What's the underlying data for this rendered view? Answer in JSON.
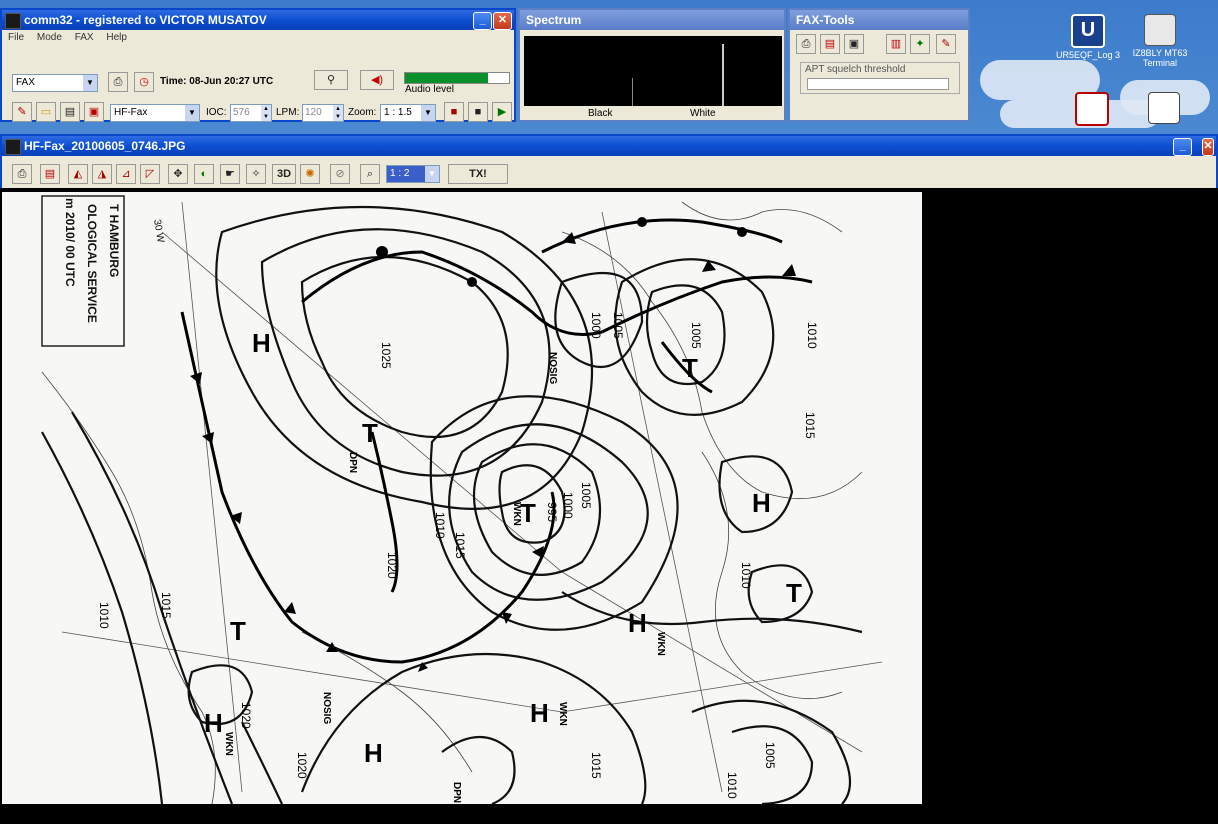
{
  "comm32": {
    "title": "comm32 - registered to VICTOR MUSATOV",
    "menu": [
      "File",
      "Mode",
      "FAX",
      "Help"
    ],
    "mode_select": "FAX",
    "time_text": "Time: 08-Jun 20:27 UTC",
    "audio_label": "Audio level",
    "audio_level": 0.8,
    "fax_type_select": "HF-Fax",
    "ioc_label": "IOC:",
    "ioc_value": "576",
    "lpm_label": "LPM:",
    "lpm_value": "120",
    "zoom_label": "Zoom:",
    "zoom_value": "1 : 1.5"
  },
  "spectrum": {
    "title": "Spectrum",
    "black_label": "Black",
    "white_label": "White"
  },
  "faxtools": {
    "title": "FAX-Tools",
    "apt_label": "APT squelch threshold"
  },
  "desktop_icons": [
    {
      "label": "UR5EQF_Log 3"
    },
    {
      "label": "IZ8BLY MT63 Terminal"
    }
  ],
  "faxwin": {
    "title": "HF-Fax_20100605_0746.JPG",
    "zoom_value": "1 : 2",
    "btn_3d": "3D",
    "btn_tx": "TX!"
  },
  "chart_text": {
    "header_line1": "T HAMBURG",
    "header_line2": "OLOGICAL SERVICE",
    "header_line3": "m 2010/ 00 UTC",
    "lon_30w": "30 W",
    "isobars": [
      "1025",
      "1000",
      "1005",
      "1005",
      "1010",
      "1015",
      "995",
      "1000",
      "1005",
      "1010",
      "1015",
      "1020",
      "1015",
      "1010",
      "1020",
      "1020",
      "1015",
      "1010",
      "1005",
      "1010"
    ],
    "h_label": "H",
    "t_label": "T",
    "nosig": "NOSIG",
    "wkn": "WKN",
    "dpn": "DPN"
  },
  "colors": {
    "titlebar": "#0b4fd0",
    "window_bg": "#ece9d8",
    "paper": "#f7f7f5"
  }
}
